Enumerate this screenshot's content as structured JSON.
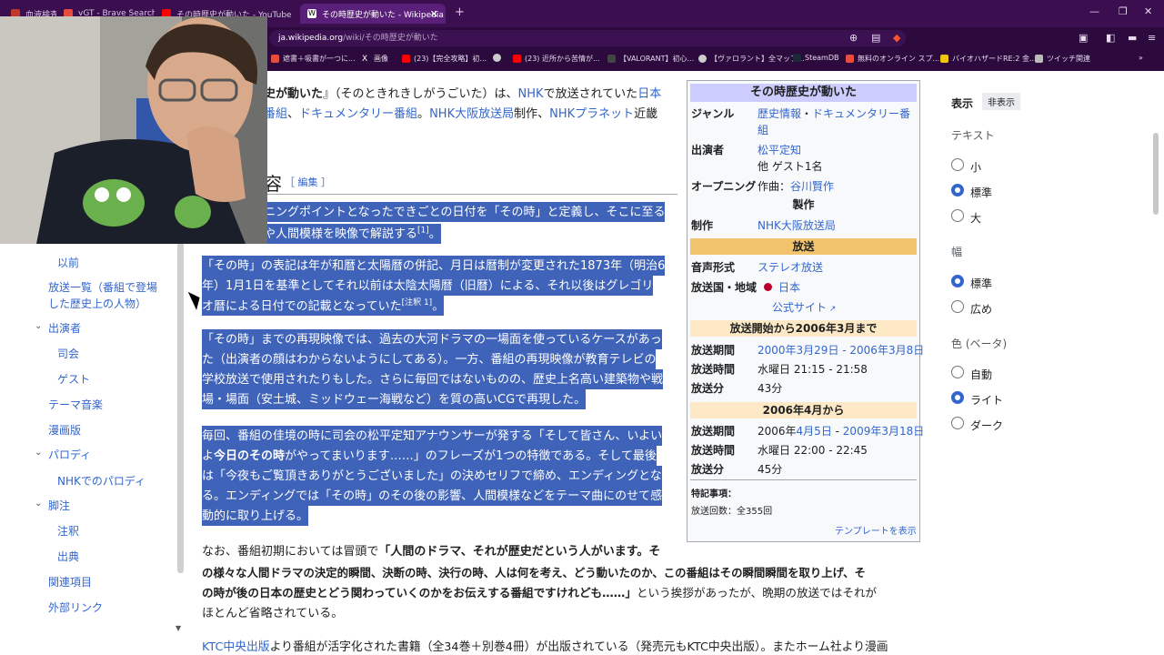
{
  "browser": {
    "tabs": [
      {
        "label": "血液検査",
        "color": "#c0392b"
      },
      {
        "label": "vGT - Brave Search",
        "color": "#e74c3c"
      },
      {
        "label": "その時歴史が動いた - YouTube",
        "color": "#ff0000"
      },
      {
        "label": "その時歴史が動いた - Wikipedia",
        "color": "#ffffff"
      }
    ],
    "url_host": "ja.wikipedia.org",
    "url_path": "/wiki/その時歴史が動いた",
    "bookmarks": [
      {
        "label": "遮書＋吸書が一つに...",
        "color": "#e74c3c"
      },
      {
        "label": "画像",
        "color": "#ffffff"
      },
      {
        "label": "(23)【完全攻略】初...",
        "color": "#ff0000"
      },
      {
        "label": "",
        "color": "#cccccc"
      },
      {
        "label": "(23) 近所から苦情が...",
        "color": "#ff0000"
      },
      {
        "label": "【VALORANT】初心...",
        "color": "#444444"
      },
      {
        "label": "【ヴァロラント】全マップ...",
        "color": "#cccccc"
      },
      {
        "label": "SteamDB",
        "color": "#1b2838"
      },
      {
        "label": "無料のオンライン スプ...",
        "color": "#e74c3c"
      },
      {
        "label": "バイオハザードRE:2 金...",
        "color": "#f1c40f"
      },
      {
        "label": "ツイッチ関連",
        "color": "#bbbbbb"
      }
    ]
  },
  "toc": {
    "items": [
      "以前",
      "放送一覧（番組で登場",
      "した歴史上の人物）",
      "出演者",
      "司会",
      "ゲスト",
      "テーマ音楽",
      "漫画版",
      "パロディ",
      "NHKでのパロディ",
      "脚注",
      "注釈",
      "出典",
      "関連項目",
      "外部リンク"
    ]
  },
  "article": {
    "intro_1a": "史が動いた",
    "intro_1b": "』（そのときれきしがうごいた）は、",
    "intro_1c": "NHK",
    "intro_1d": "で放送されていた",
    "intro_1e": "日本",
    "intro_2a": "番組",
    "intro_2b": "、",
    "intro_2c": "ドキュメンタリー番組",
    "intro_2d": "。",
    "intro_2e": "NHK大阪放送局",
    "intro_2f": "制作、",
    "intro_2g": "NHKプラネット",
    "intro_2h": "近畿",
    "section_glyph": "容",
    "edit_label": "［ 編集 ］",
    "p1_l1": "ニングポイントとなったできごとの日付を「その時」と定義し、そこに至る",
    "p1_l2": "や人間模様を映像で解説する",
    "p1_ref": "[1]",
    "p1_end": "。",
    "p2_l1": "「その時」の表記は年が和暦と太陽暦の併記、月日は暦制が変更された1873年（明治6",
    "p2_l2": "年）1月1日を基準としてそれ以前は太陰太陽暦（旧暦）による、それ以後はグレゴリ",
    "p2_l3": "オ暦による日付での記載となっていた",
    "p2_ref": "[注釈 1]",
    "p2_end": "。",
    "p3_l1": "「その時」までの再現映像では、過去の大河ドラマの一場面を使っているケースがあっ",
    "p3_l2": "た（出演者の顔はわからないようにしてある）。一方、番組の再現映像が教育テレビの",
    "p3_l3": "学校放送で使用されたりもした。さらに毎回ではないものの、歴史上名高い建築物や戦",
    "p3_l4": "場・場面（安土城、ミッドウェー海戦など）を質の高いCGで再現した。",
    "p4_l1": "毎回、番組の佳境の時に司会の松平定知アナウンサーが発する「そして皆さん、いよい",
    "p4_l2a": "よ",
    "p4_l2b": "今日のその時",
    "p4_l2c": "がやってまいります……」のフレーズが1つの特徴である。そして最後",
    "p4_l3": "は「今夜もご覧頂きありがとうございました」の決めセリフで締め、エンディングとな",
    "p4_l4": "る。エンディングでは「その時」のその後の影響、人間模様などをテーマ曲にのせて感",
    "p4_l5": "動的に取り上げる。",
    "p5_l1a": "なお、番組初期においては冒頭で",
    "p5_l1b": "「人間のドラマ、それが歴史だという人がいます。そ",
    "p5_l2": "の様々な人間ドラマの決定的瞬間、決断の時、決行の時、人は何を考え、どう動いたのか、この番組はその瞬間瞬間を取り上げ、そ",
    "p5_l3a": "の時が後の日本の歴史とどう関わっていくのかをお伝えする番組ですけれども……」",
    "p5_l3b": "という挨拶があったが、晩期の放送ではそれが",
    "p5_l4": "ほとんど省略されている。",
    "p6_a": "KTC中央出版",
    "p6_b": "より番組が活字化された書籍（全34巻＋別巻4冊）が出版されている（発売元もKTC中央出版）。またホーム社より漫画"
  },
  "infobox": {
    "title": "その時歴史が動いた",
    "genre_label": "ジャンル",
    "genre_a": "歴史情報",
    "genre_sep": "・",
    "genre_b": "ドキュメンタリー番",
    "genre_c": "組",
    "cast_label": "出演者",
    "cast_a": "松平定知",
    "cast_b": "他 ゲスト1名",
    "opening_label": "オープニング",
    "opening_pre": "作曲：",
    "opening_val": "谷川賢作",
    "production_head": "製作",
    "prod_label": "制作",
    "prod_val": "NHK大阪放送局",
    "broadcast_head": "放送",
    "audio_label": "音声形式",
    "audio_val": "ステレオ放送",
    "country_label": "放送国・地域",
    "country_val": "日本",
    "official": "公式サイト",
    "period1_head": "放送開始から2006年3月まで",
    "p1_period_label": "放送期間",
    "p1_period_val": "2000年3月29日 - 2006年3月8日",
    "p1_time_label": "放送時間",
    "p1_time_val": "水曜日 21:15 - 21:58",
    "p1_min_label": "放送分",
    "p1_min_val": "43分",
    "period2_head": "2006年4月から",
    "p2_period_label": "放送期間",
    "p2_period_pre": "2006年",
    "p2_period_a": "4月5日",
    "p2_period_b": " - ",
    "p2_period_c": "2009年3月18日",
    "p2_time_label": "放送時間",
    "p2_time_val": "水曜日 22:00 - 22:45",
    "p2_min_label": "放送分",
    "p2_min_val": "45分",
    "notes_label": "特記事項：",
    "notes_val": "放送回数：全355回",
    "template_link": "テンプレートを表示"
  },
  "sidebar": {
    "display": "表示",
    "hide": "非表示",
    "text": "テキスト",
    "small": "小",
    "standard": "標準",
    "large": "大",
    "width": "幅",
    "width_standard": "標準",
    "width_wide": "広め",
    "color": "色 (ベータ)",
    "auto": "自動",
    "light": "ライト",
    "dark": "ダーク"
  },
  "colors": {
    "selection": "#3f63b8",
    "link": "#3366cc",
    "infobox_title": "#ccccff",
    "infobox_broadcast": "#f2c46d",
    "infobox_period": "#fde9c6"
  }
}
